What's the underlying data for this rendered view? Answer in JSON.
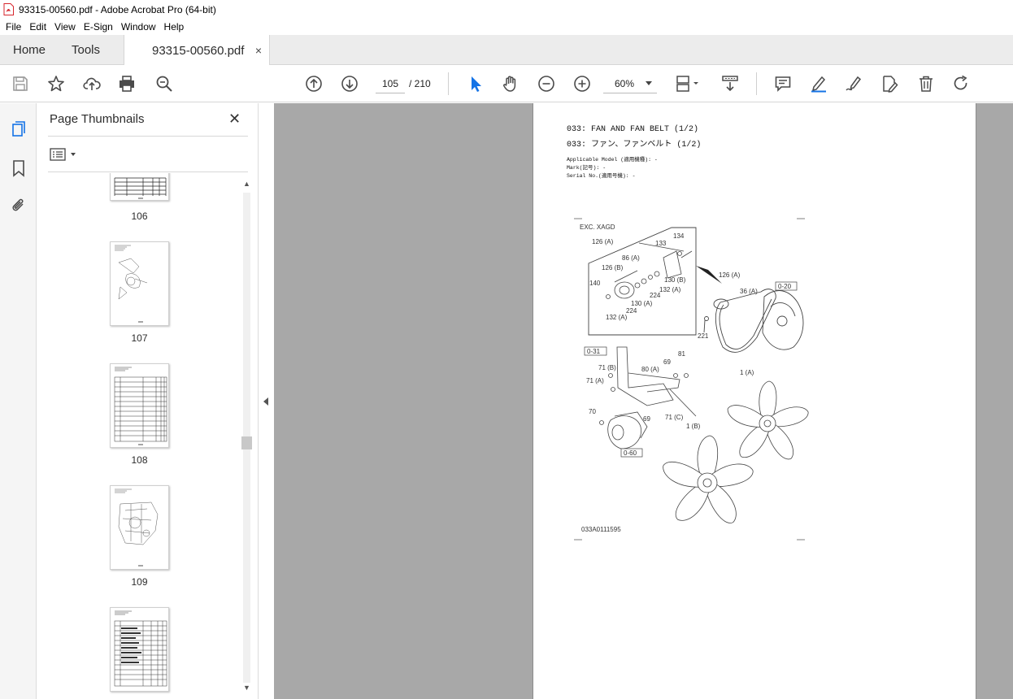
{
  "window": {
    "title": "93315-00560.pdf - Adobe Acrobat Pro (64-bit)"
  },
  "menu": [
    "File",
    "Edit",
    "View",
    "E-Sign",
    "Window",
    "Help"
  ],
  "tabs": {
    "home": "Home",
    "tools": "Tools",
    "document": "93315-00560.pdf",
    "close": "×"
  },
  "nav": {
    "current_page": "105",
    "total_pages": "/ 210",
    "zoom": "60%"
  },
  "panel": {
    "title": "Page Thumbnails",
    "close": "✕",
    "thumbnails": [
      {
        "label": "106"
      },
      {
        "label": "107"
      },
      {
        "label": "108"
      },
      {
        "label": "109"
      },
      {
        "label": ""
      }
    ]
  },
  "page": {
    "title_en": "033: FAN AND FAN BELT (1/2)",
    "title_jp": "033: ファン、ファンベルト (1/2)",
    "applicable_model": "Applicable Model (適用機種): -",
    "mark": "Mark(記号): -",
    "serial_no": "Serial No.(適用号機): -",
    "diagram": {
      "box_label": "EXC. XAGD",
      "figure_code": "033A0111595",
      "callouts": [
        "126 (A)",
        "133",
        "134",
        "86 (A)",
        "126 (B)",
        "130 (B)",
        "132 (A)",
        "140",
        "224",
        "224",
        "130 (A)",
        "132 (A)",
        "126 (A)",
        "36 (A)",
        "0-20",
        "221",
        "0-31",
        "71 (B)",
        "71 (A)",
        "80 (A)",
        "69",
        "81",
        "1 (A)",
        "70",
        "69",
        "71 (C)",
        "0-60",
        "1 (B)"
      ]
    }
  },
  "colors": {
    "accent": "#1473e6",
    "tab_bg": "#ececec",
    "viewer_bg": "#a8a8a8",
    "pdf_red": "#d7262d"
  }
}
